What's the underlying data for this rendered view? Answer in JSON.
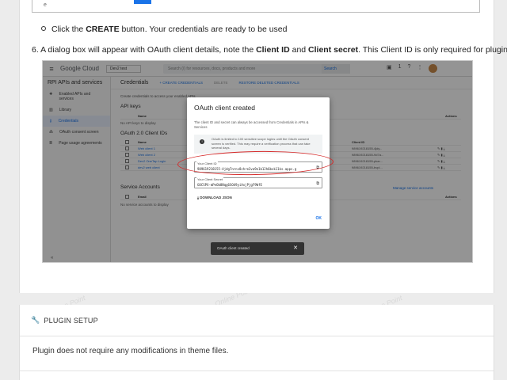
{
  "instructions": {
    "step_create_prefix": "Click the ",
    "step_create_bold": "CREATE",
    "step_create_suffix": " button. Your credentials are ready to be used",
    "step6_prefix": "6. A dialog box will appear with OAuth client details, note the ",
    "step6_bold1": "Client ID",
    "step6_mid": " and ",
    "step6_bold2": "Client secret",
    "step6_suffix": ". This Client ID is only required for plugin."
  },
  "top_frame": {
    "marker": "e"
  },
  "screenshot": {
    "topbar": {
      "logo": "Google Cloud",
      "project": "Dev2 test",
      "search_placeholder": "Search (/) for resources, docs, products and more",
      "search_button": "Search",
      "badge": "1"
    },
    "sidebar": {
      "title": "APIs and services",
      "items": [
        {
          "label": "Enabled APIs and services"
        },
        {
          "label": "Library"
        },
        {
          "label": "Credentials"
        },
        {
          "label": "OAuth consent screen"
        },
        {
          "label": "Page usage agreements"
        }
      ]
    },
    "main": {
      "title": "Credentials",
      "create_btn": "+ CREATE CREDENTIALS",
      "delete_btn": "DELETE",
      "restore_btn": "RESTORE DELETED CREDENTIALS",
      "intro": "Create credentials to access your enabled APIs",
      "api_keys_title": "API keys",
      "api_keys_empty": "No API keys to display",
      "name_col": "Name",
      "actions_col": "Actions",
      "oauth_title": "OAuth 2.0 Client IDs",
      "client_id_col": "Client ID",
      "oauth_rows": [
        {
          "name": "Web client 1",
          "id": "989619218155-4jdy..."
        },
        {
          "name": "Web client 2",
          "id": "989619218155-9d7a..."
        },
        {
          "name": "Dev2 OneTap Login",
          "id": "989619218155-pkar..."
        },
        {
          "name": "dev2 web client",
          "id": "989619218155-bvpl..."
        }
      ],
      "service_title": "Service Accounts",
      "manage_link": "Manage service accounts",
      "email_col": "Email",
      "service_empty": "No service accounts to display"
    },
    "dialog": {
      "title": "OAuth client created",
      "desc": "The client ID and secret can always be accessed from Credentials in APIs & Services",
      "info": "OAuth is limited to 100 sensitive scope logins until the OAuth consent screen is verified. This may require a verification process that can take several days.",
      "client_id_label": "Your Client ID",
      "client_id_value": "989619218155-4jdg7nrnv8chre3va9e1b12h6bvk11ks.apps.g",
      "client_secret_label": "Your Client Secret",
      "client_secret_value": "GOCSPX-mPeOb8Nqg6SO49yiAxjPjgF9WfE",
      "download": "DOWNLOAD JSON",
      "ok": "OK"
    },
    "toast": {
      "text": "OAuth client created",
      "close": "✕"
    }
  },
  "plugin_setup": {
    "header": "PLUGIN SETUP",
    "body": "Plugin does not require any modifications in theme files."
  }
}
